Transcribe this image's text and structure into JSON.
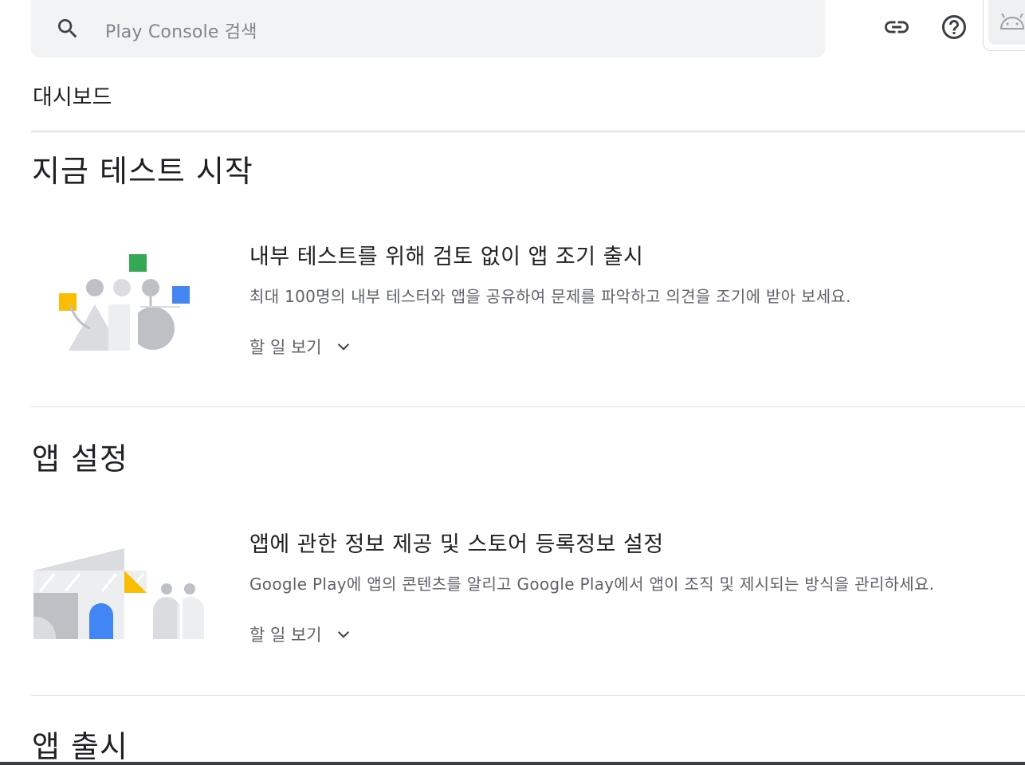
{
  "search": {
    "placeholder": "Play Console 검색",
    "icon": "search-icon"
  },
  "toolbar": {
    "link_icon": "link-icon",
    "help_icon": "help-icon",
    "avatar_icon": "android-icon"
  },
  "header": {
    "title": "대시보드"
  },
  "sections": [
    {
      "title": "지금 테스트 시작",
      "card": {
        "title": "내부 테스트를 위해 검토 없이 앱 조기 출시",
        "description": "최대 100명의 내부 테스터와 앱을 공유하여 문제를 파악하고 의견을 조기에 받아 보세요.",
        "link": "할 일 보기"
      }
    },
    {
      "title": "앱 설정",
      "card": {
        "title": "앱에 관한 정보 제공 및 스토어 등록정보 설정",
        "description": "Google Play에 앱의 콘텐츠를 알리고 Google Play에서 앱이 조직 및 제시되는 방식을 관리하세요.",
        "link": "할 일 보기"
      }
    },
    {
      "title": "앱 출시"
    }
  ],
  "colors": {
    "green": "#34a853",
    "blue": "#4285f4",
    "yellow": "#fbbc04",
    "grey": "#bdc1c6",
    "light_grey": "#dadce0"
  }
}
